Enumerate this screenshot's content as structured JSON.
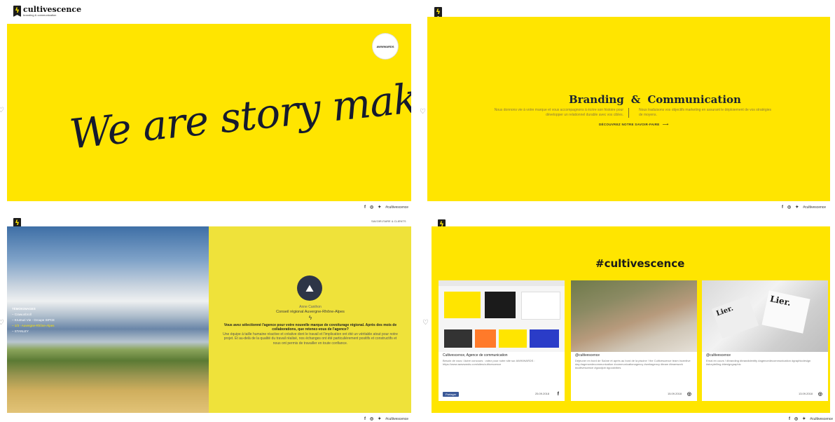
{
  "brand": {
    "name": "cultivescence",
    "tagline": "branding & communication"
  },
  "footer": {
    "hashtag": "#cultivescence",
    "facebook_icon": "f",
    "instagram_icon": "◎",
    "twitter_icon": "🐦"
  },
  "panel1": {
    "headline": "We are story makers!",
    "badge_text": "AWWWARDS"
  },
  "panel2": {
    "title_left": "Branding",
    "ampersand": "&",
    "title_right": "Communication",
    "desc_left": "Nous donnons vie à votre marque et vous accompagnons à écrire son histoire pour développer un relationnel durable avec vos cibles.",
    "desc_right": "Nous traduisons vos objectifs marketing en assurant le déploiement de vos stratégies de moyens.",
    "cta": "DÉCOUVREZ NOTRE SAVOIR-FAIRE"
  },
  "panel3": {
    "breadcrumb": "SAVOIR-FAIRE & CLIENTS",
    "nav_title": "TÉMOIGNAGES",
    "nav_items": [
      "Crawunbroll",
      "Krumuri Vie - Groupe ISPCE",
      "1/3 - Auvergne-Rhône-Alpes",
      "STANLEY"
    ],
    "person_name": "Anne Canihon",
    "person_org": "Conseil régional Auvergne-Rhône-Alpes",
    "question": "Vous avez sélectionné l'agence pour votre nouvelle marque de covoiturage régional. Après des mois de collaborations, que retenez-vous de l'agence?",
    "answer": "Une équipe à taille humaine réactive et créative dont le travail et l'implication ont été un véritable atout pour notre projet. Et au-delà de la qualité du travail réalisé, nos échanges ont été particulièrement positifs et constructifs et nous ont permis de travailler en toute confiance."
  },
  "panel4": {
    "title": "#cultivescence",
    "cards": [
      {
        "title": "Cultivescence, Agence de communication",
        "text": "Besoin de vous ! Autre concours : votez pour notre site sur AWWWARDS : https://www.awwwards.com/sites/cultivescence",
        "date": "25.09.2018",
        "icon": "f",
        "share": "Partager"
      },
      {
        "title": "@cultivescence",
        "text": "Déjeuner en bord de Saône et après au bord de la piscine ! the Cultivescence team incentive day #agencedecommunication #communicationagency #webagency #team #teamwork #cultivescence #goodjob #goodvibes",
        "date": "15.09.2018",
        "icon": "◎"
      },
      {
        "title": "@cultivescence",
        "text": "Ernai en cours ! #branding #brandidentity #agencedecommunication #graphicdesign #storytelling #designgraphic",
        "date": "13.09.2018",
        "icon": "◎"
      }
    ]
  },
  "colors": {
    "accent": "#ffe500",
    "dark": "#1c2431"
  }
}
